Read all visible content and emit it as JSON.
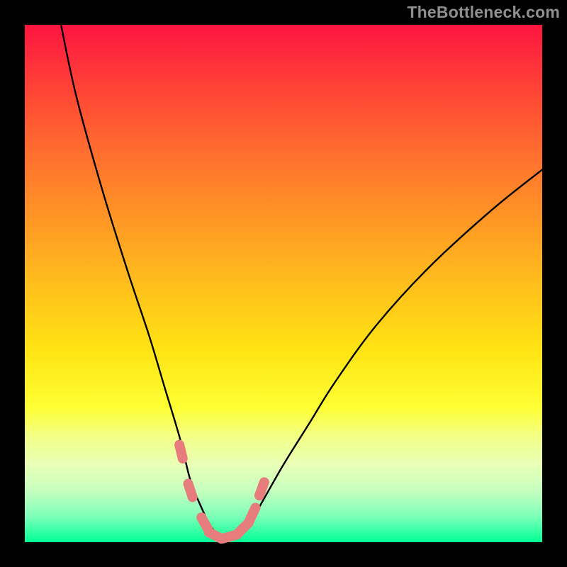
{
  "watermark": "TheBottleneck.com",
  "colors": {
    "frame": "#000000",
    "curve_stroke": "#000000",
    "nub_fill": "#e77c7c",
    "gradient_top": "#fe1541",
    "gradient_bottom": "#00ff95"
  },
  "chart_data": {
    "type": "line",
    "title": "",
    "xlabel": "",
    "ylabel": "",
    "xlim": [
      0,
      100
    ],
    "ylim": [
      0,
      100
    ],
    "grid": false,
    "legend": false,
    "series": [
      {
        "name": "bottleneck-curve",
        "x": [
          7,
          10,
          15,
          20,
          24,
          27,
          30,
          32,
          34,
          36,
          38,
          40,
          43,
          46,
          50,
          55,
          60,
          68,
          78,
          90,
          100
        ],
        "values": [
          100,
          86,
          68,
          52,
          40,
          30,
          20,
          12,
          7,
          3,
          1,
          1,
          3,
          8,
          15,
          23,
          31,
          42,
          53,
          64,
          72
        ]
      }
    ],
    "annotations": [
      {
        "name": "highlight-nubs",
        "style": "rounded-capsules",
        "points_x": [
          30.2,
          32.0,
          34.8,
          36.8,
          39.7,
          42.3,
          44.0,
          45.8
        ],
        "points_y": [
          17.5,
          10.0,
          3.6,
          1.3,
          1.1,
          2.8,
          5.4,
          10.3
        ]
      }
    ]
  }
}
